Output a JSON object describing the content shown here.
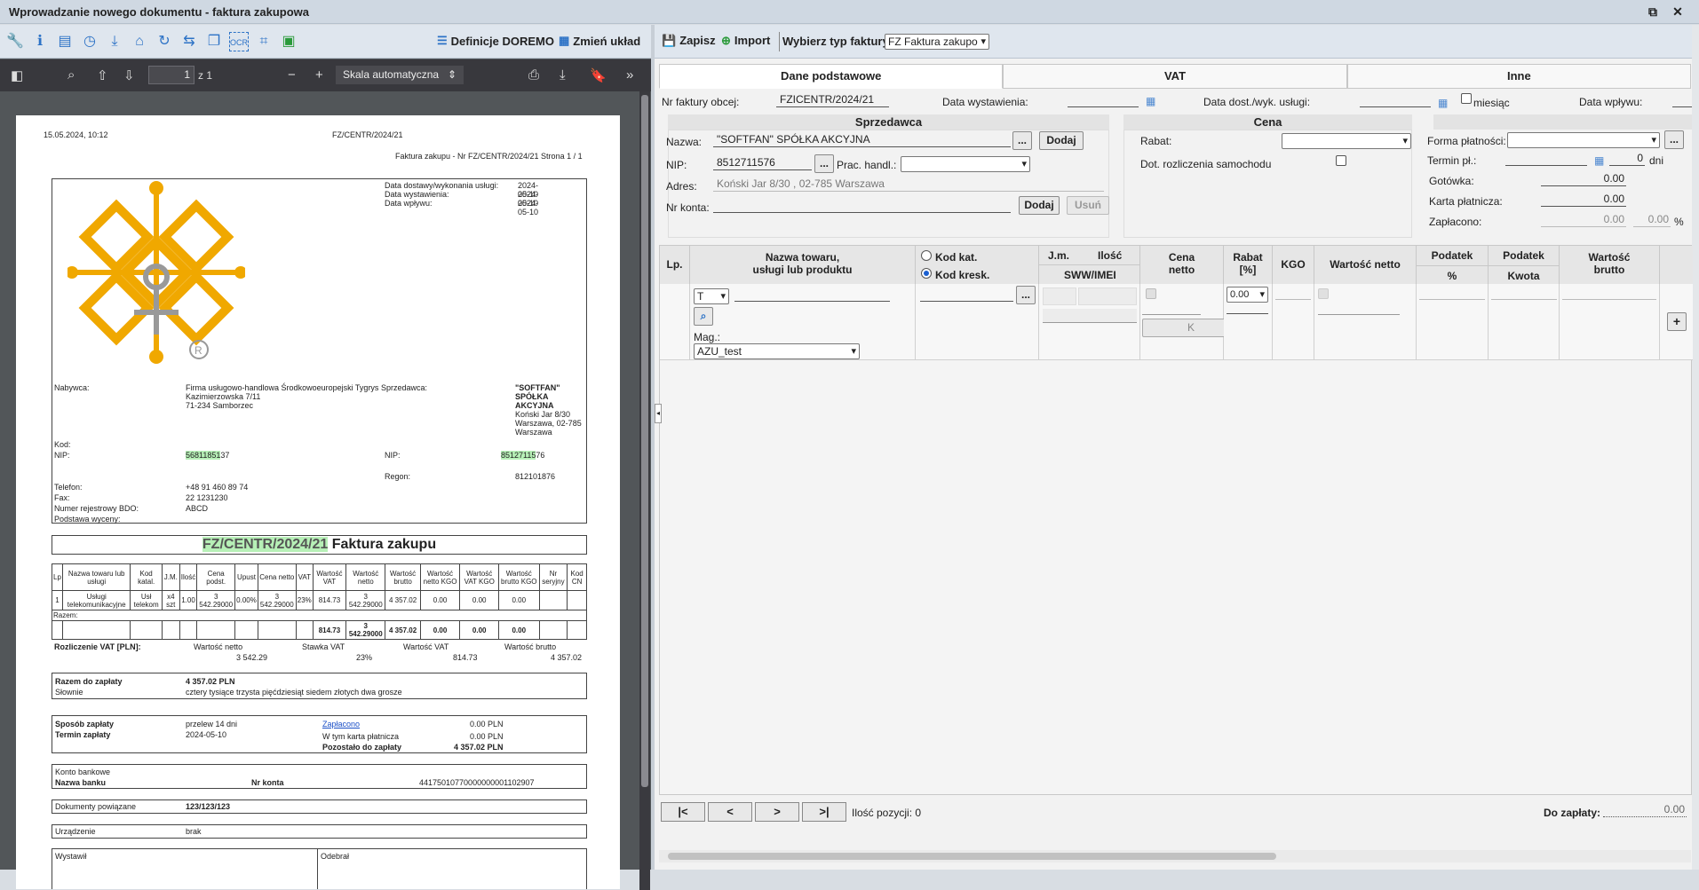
{
  "window": {
    "title": "Wprowadzanie nowego dokumentu - faktura zakupowa"
  },
  "left_toolbar": {
    "doremo_label": "Definicje DOREMO",
    "layout_label": "Zmień układ"
  },
  "pdf_toolbar": {
    "page": "1",
    "page_total": "z 1",
    "zoom": "Skala automatyczna"
  },
  "pdf": {
    "timestamp": "15.05.2024, 10:12",
    "doc_number_top": "FZ/CENTR/2024/21",
    "header_line": "Faktura zakupu - Nr FZ/CENTR/2024/21 Strona 1 / 1",
    "dates": [
      {
        "label": "Data dostawy/wykonania usługi:",
        "value": "2024-05-10"
      },
      {
        "label": "Data wystawienia:",
        "value": "2024-05-10"
      },
      {
        "label": "Data wpływu:",
        "value": "2024-05-10"
      }
    ],
    "buyer_label": "Nabywca:",
    "buyer_text": "Firma usługowo-handlowa Środkowoeuropejski Tygrys Sprzedawca:",
    "buyer_addr1": "Kazimierzowska 7/11",
    "buyer_addr2": "71-234 Samborzec",
    "seller_name1": "\"SOFTFAN\"",
    "seller_name2": "SPÓŁKA",
    "seller_name3": "AKCYJNA",
    "seller_addr1": "Koński Jar 8/30",
    "seller_addr2": "Warszawa, 02-785",
    "seller_addr3": "Warszawa",
    "kod_label": "Kod:",
    "nip_label": "NIP:",
    "buyer_nip_hl": "56811851",
    "buyer_nip_rest": "37",
    "seller_nip_label": "NIP:",
    "seller_nip_hl": "85127115",
    "seller_nip_rest": "76",
    "regon_label": "Regon:",
    "regon": "812101876",
    "telefon_label": "Telefon:",
    "telefon": "+48 91 460 89 74",
    "fax_label": "Fax:",
    "fax": "22 1231230",
    "bdo_label": "Numer rejestrowy BDO:",
    "bdo": "ABCD",
    "podstawa_label": "Podstawa wyceny:",
    "title_hl": "FZ/CENTR/2024/21",
    "title_rest": " Faktura zakupu",
    "table_headers": [
      "Lp",
      "Nazwa towaru lub usługi",
      "Kod katal.",
      "J.M.",
      "Ilość",
      "Cena podst.",
      "Upust",
      "Cena netto",
      "VAT",
      "Wartość VAT",
      "Wartość netto",
      "Wartość brutto",
      "Wartość netto KGO",
      "Wartość VAT KGO",
      "Wartość brutto KGO",
      "Nr seryjny",
      "Kod CN"
    ],
    "table_row": [
      "1",
      "Usługi telekomunikacyjne",
      "Usł telekom",
      "x4 szt",
      "1.00",
      "3 542.29000",
      "0.00%",
      "3 542.29000",
      "23%",
      "814.73",
      "3 542.29000",
      "4 357.02",
      "0.00",
      "0.00",
      "0.00",
      "",
      ""
    ],
    "razem_label": "Razem:",
    "razem_row": [
      "814.73",
      "3 542.29000",
      "4 357.02",
      "0.00",
      "0.00",
      "0.00"
    ],
    "vat_label": "Rozliczenie VAT [PLN]:",
    "vat_headers": [
      "Wartość netto",
      "Stawka VAT",
      "Wartość VAT",
      "Wartość brutto"
    ],
    "vat_values": [
      "3 542.29",
      "23%",
      "814.73",
      "4 357.02"
    ],
    "razem_zaplaty_label": "Razem do zapłaty",
    "razem_zaplaty": "4 357.02 PLN",
    "slownie_label": "Słownie",
    "slownie": "cztery tysiące trzysta pięćdziesiąt siedem złotych dwa grosze",
    "sposob_label": "Sposób zapłaty",
    "sposob": "przelew 14 dni",
    "termin_label": "Termin zapłaty",
    "termin": "2024-05-10",
    "zaplacono_label": "Zapłacono",
    "zaplacono": "0.00 PLN",
    "karta_label": "W tym karta płatnicza",
    "karta": "0.00 PLN",
    "pozostalo_label": "Pozostało do zapłaty",
    "pozostalo": "4 357.02 PLN",
    "konto_label": "Konto bankowe",
    "bank_label": "Nazwa banku",
    "nrkonta_label": "Nr konta",
    "nrkonta": "44175010770000000001102907",
    "dok_label": "Dokumenty powiązane",
    "dok": "123/123/123",
    "urz_label": "Urządzenie",
    "urz": "brak",
    "wystawil": "Wystawił",
    "odebral": "Odebrał"
  },
  "right_toolbar": {
    "save": "Zapisz",
    "import": "Import",
    "type_label": "Wybierz typ faktury",
    "type_value": "FZ Faktura zakupo"
  },
  "tabs": [
    "Dane podstawowe",
    "VAT",
    "Inne"
  ],
  "form": {
    "nr_faktury_label": "Nr faktury obcej:",
    "nr_faktury": "FZICENTR/2024/21",
    "data_wyst_label": "Data wystawienia:",
    "data_dost_label": "Data dost./wyk. usługi:",
    "miesiac_label": "miesiąc",
    "data_wplywu_label": "Data wpływu:",
    "sprzedawca_header": "Sprzedawca",
    "cena_header": "Cena",
    "nazwa_label": "Nazwa:",
    "nazwa": "\"SOFTFAN\" SPÓŁKA AKCYJNA",
    "dodaj_label": "Dodaj",
    "nip_label": "NIP:",
    "nip": "8512711576",
    "prac_label": "Prac. handl.:",
    "adres_label": "Adres:",
    "adres": "Koński Jar 8/30 , 02-785 Warszawa",
    "nrkonta_label": "Nr konta:",
    "dodaj2_label": "Dodaj",
    "usun_label": "Usuń",
    "rabat_label": "Rabat:",
    "dot_label": "Dot. rozliczenia samochodu",
    "forma_label": "Forma płatności:",
    "termin_label": "Termin pł.:",
    "termin_value": "0",
    "dni_label": "dni",
    "gotowka_label": "Gotówka:",
    "gotowka": "0.00",
    "karta_label": "Karta płatnicza:",
    "karta": "0.00",
    "zaplacono_label": "Zapłacono:",
    "zaplacono": "0.00",
    "zaplacono_pct": "0.00",
    "pct": "%"
  },
  "grid": {
    "lp": "Lp.",
    "nazwa_h1": "Nazwa towaru,",
    "nazwa_h2": "usługi lub produktu",
    "kod_kat": "Kod kat.",
    "kod_kresk": "Kod kresk.",
    "jm": "J.m.",
    "ilosc": "Ilość",
    "sww": "SWW/IMEI",
    "cena_h1": "Cena",
    "cena_h2": "netto",
    "rabat_h1": "Rabat",
    "rabat_h2": "[%]",
    "kgo": "KGO",
    "wart_netto": "Wartość netto",
    "podatek1": "Podatek",
    "podatek_pct": "%",
    "podatek2": "Podatek",
    "kwota": "Kwota",
    "brutto_h1": "Wartość",
    "brutto_h2": "brutto",
    "type_value": "T",
    "rabat_value": "0.00",
    "k_label": "K",
    "mag_label": "Mag.:",
    "mag_value": "AZU_test"
  },
  "footer": {
    "first": "|<",
    "prev": "<",
    "next": ">",
    "last": ">|",
    "count_label": "Ilość pozycji: 0",
    "do_zaplaty_label": "Do zapłaty:",
    "do_zaplaty": "0.00"
  }
}
